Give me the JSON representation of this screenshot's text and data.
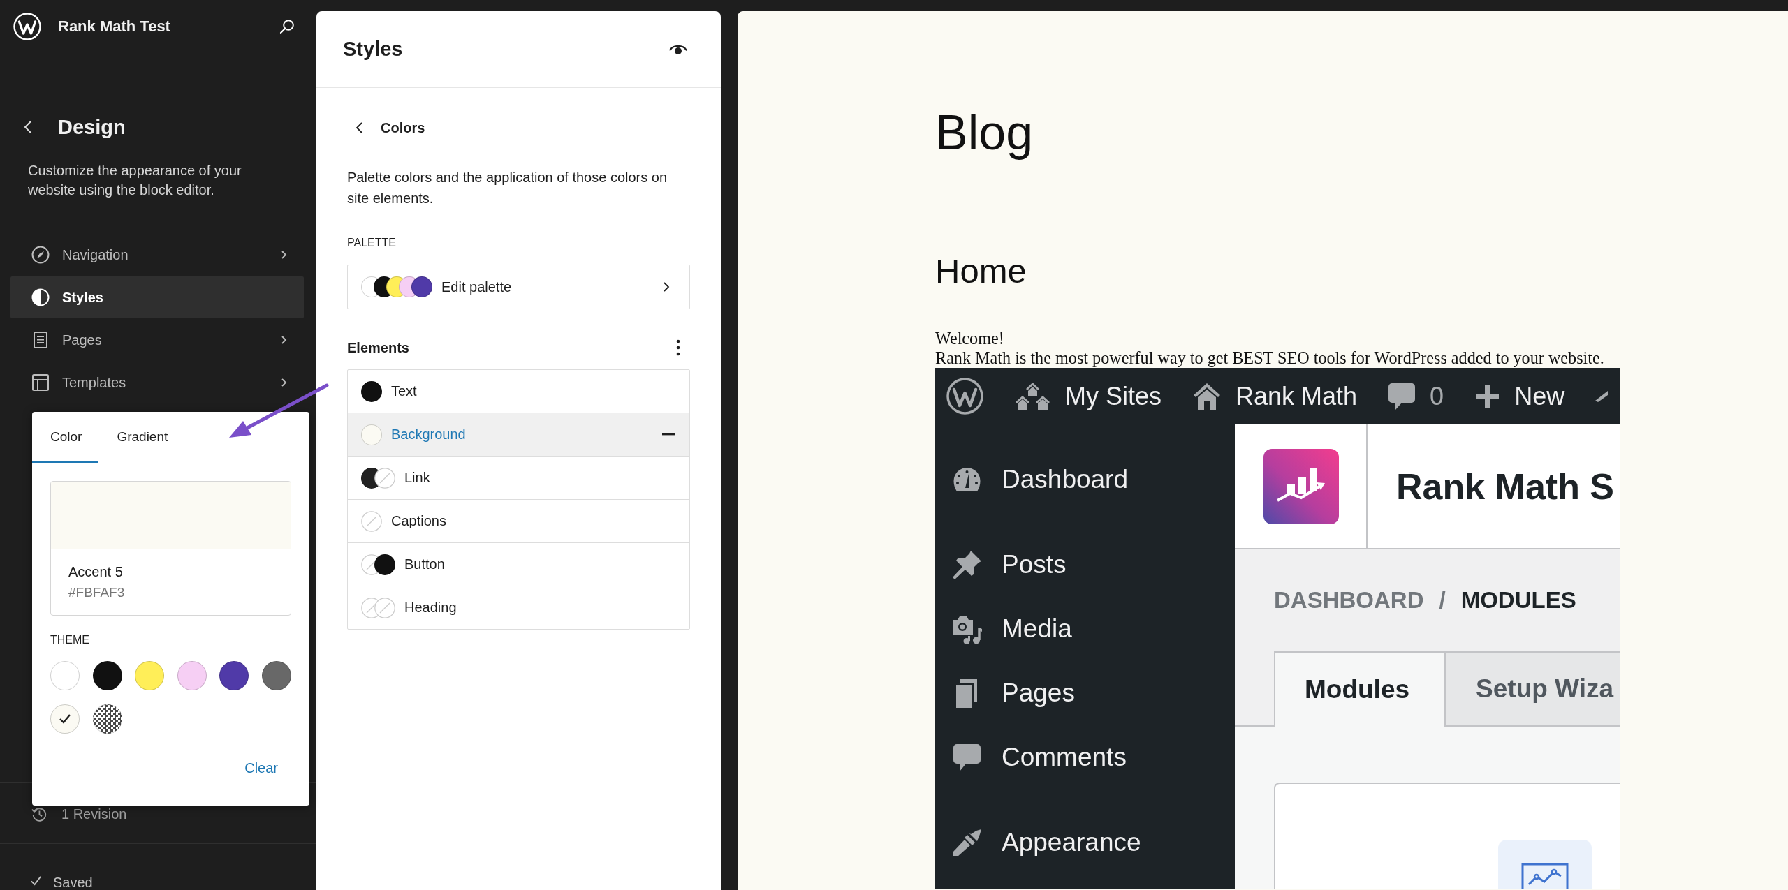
{
  "sidebar": {
    "site_title": "Rank Math Test",
    "section_title": "Design",
    "description": "Customize the appearance of your website using the block editor.",
    "items": [
      {
        "kind": "navigation",
        "label": "Navigation",
        "selected": false
      },
      {
        "kind": "styles",
        "label": "Styles",
        "selected": true
      },
      {
        "kind": "pages",
        "label": "Pages",
        "selected": false
      },
      {
        "kind": "templates",
        "label": "Templates",
        "selected": false
      }
    ],
    "revisions": "1 Revision",
    "status": "Saved"
  },
  "color_popover": {
    "tabs": [
      {
        "label": "Color",
        "selected": true
      },
      {
        "label": "Gradient",
        "selected": false
      }
    ],
    "current": {
      "name": "Accent 5",
      "value": "#FBFAF3",
      "color": "#fbfaf3"
    },
    "section_label": "THEME",
    "swatches": [
      {
        "kind": "solid",
        "color": "#ffffff",
        "selected": false
      },
      {
        "kind": "solid",
        "color": "#111111",
        "selected": false
      },
      {
        "kind": "solid",
        "color": "#ffee58",
        "selected": false
      },
      {
        "kind": "solid",
        "color": "#f6cff4",
        "selected": false
      },
      {
        "kind": "solid",
        "color": "#503aa8",
        "selected": false
      },
      {
        "kind": "solid",
        "color": "#686868",
        "selected": false
      },
      {
        "kind": "solid",
        "color": "#fbfaf3",
        "selected": true
      },
      {
        "kind": "transparent",
        "selected": false
      }
    ],
    "clear_label": "Clear"
  },
  "styles_panel": {
    "title": "Styles",
    "subtitle": "Colors",
    "description": "Palette colors and the application of those colors on site elements.",
    "palette_label": "PALETTE",
    "palette": {
      "label": "Edit palette",
      "swatches": [
        {
          "color": "#ffffff"
        },
        {
          "color": "#111111"
        },
        {
          "color": "#ffee58"
        },
        {
          "color": "#f6cff4"
        },
        {
          "color": "#503aa8"
        }
      ]
    },
    "elements_label": "Elements",
    "elements": [
      {
        "label": "Text",
        "selected": false,
        "swatches": [
          {
            "kind": "solid",
            "color": "#111111"
          }
        ]
      },
      {
        "label": "Background",
        "selected": true,
        "swatches": [
          {
            "kind": "solid",
            "color": "#fbfaf3"
          }
        ]
      },
      {
        "label": "Link",
        "selected": false,
        "swatches": [
          {
            "kind": "solid",
            "color": "#222222"
          },
          {
            "kind": "none"
          }
        ]
      },
      {
        "label": "Captions",
        "selected": false,
        "swatches": [
          {
            "kind": "none"
          }
        ]
      },
      {
        "label": "Button",
        "selected": false,
        "swatches": [
          {
            "kind": "none"
          },
          {
            "kind": "solid",
            "color": "#111111"
          }
        ]
      },
      {
        "label": "Heading",
        "selected": false,
        "swatches": [
          {
            "kind": "none"
          },
          {
            "kind": "none"
          }
        ]
      }
    ]
  },
  "preview": {
    "title": "Blog",
    "heading": "Home",
    "lines": [
      "Welcome!",
      "Rank Math is the most powerful way to get BEST SEO tools for WordPress added to your website."
    ],
    "screenshot": {
      "admin_bar": [
        {
          "kind": "logo"
        },
        {
          "kind": "sites",
          "label": "My Sites"
        },
        {
          "kind": "home",
          "label": "Rank Math"
        },
        {
          "kind": "comments",
          "label": "0"
        },
        {
          "kind": "new",
          "label": "New"
        },
        {
          "kind": "cutoff"
        }
      ],
      "menu_groups": [
        {
          "items": [
            {
              "kind": "dashboard",
              "label": "Dashboard"
            }
          ]
        },
        {
          "items": [
            {
              "kind": "posts",
              "label": "Posts"
            },
            {
              "kind": "media",
              "label": "Media"
            },
            {
              "kind": "pages",
              "label": "Pages"
            },
            {
              "kind": "comments",
              "label": "Comments"
            }
          ]
        },
        {
          "items": [
            {
              "kind": "appearance",
              "label": "Appearance"
            }
          ]
        }
      ],
      "page_title": "Rank Math S",
      "breadcrumb": {
        "items": [
          "DASHBOARD",
          "MODULES"
        ],
        "separator": "/"
      },
      "tabs": [
        {
          "label": "Modules",
          "selected": true
        },
        {
          "label": "Setup Wiza",
          "selected": false
        }
      ]
    }
  }
}
